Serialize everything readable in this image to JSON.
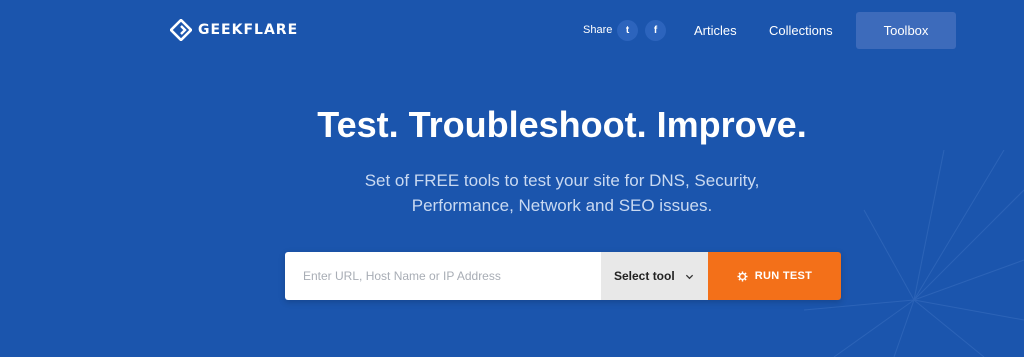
{
  "brand": {
    "name": "GEEKFLARE",
    "logo_icon": "geekflare-logo-icon"
  },
  "header": {
    "share_label": "Share",
    "social": [
      {
        "name": "twitter",
        "glyph": "t"
      },
      {
        "name": "facebook",
        "glyph": "f"
      }
    ],
    "nav": [
      {
        "label": "Articles"
      },
      {
        "label": "Collections"
      }
    ],
    "toolbox_label": "Toolbox"
  },
  "hero": {
    "title": "Test. Troubleshoot. Improve.",
    "subtitle_line1": "Set of FREE tools to test your site for DNS, Security,",
    "subtitle_line2": "Performance, Network and SEO issues."
  },
  "search": {
    "placeholder": "Enter URL, Host Name or IP Address",
    "value": "",
    "select_label": "Select tool",
    "run_label": "RUN TEST"
  },
  "colors": {
    "background": "#1b55ad",
    "accent": "#f37019",
    "toolbox_button": "#3d6bbb",
    "select_bg": "#e8e8e8"
  }
}
